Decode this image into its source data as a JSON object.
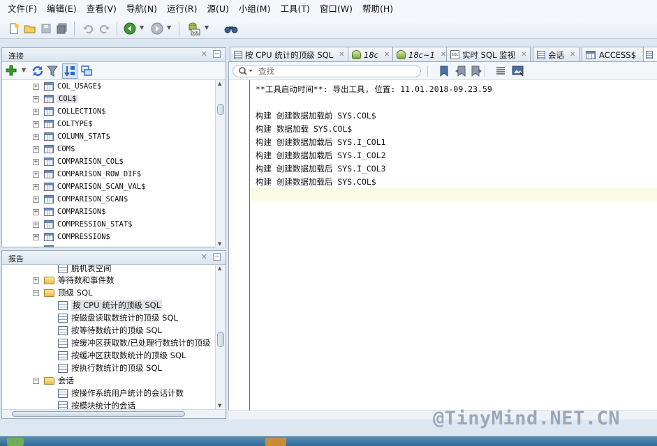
{
  "menu": [
    "文件(F)",
    "编辑(E)",
    "查看(V)",
    "导航(N)",
    "运行(R)",
    "源(U)",
    "小组(M)",
    "工具(T)",
    "窗口(W)",
    "帮助(H)"
  ],
  "toolbar_icons": [
    "new-icon",
    "open-icon",
    "save-icon",
    "save-all-icon",
    "undo-icon",
    "redo-icon",
    "back-icon",
    "forward-icon",
    "sql-worksheet-icon",
    "binoculars-icon"
  ],
  "connections": {
    "title": "连接",
    "items": [
      "COL_USAGE$",
      "COL$",
      "COLLECTION$",
      "COLTYPE$",
      "COLUMN_STAT$",
      "COM$",
      "COMPARISON_COL$",
      "COMPARISON_ROW_DIF$",
      "COMPARISON_SCAN_VAL$",
      "COMPARISON_SCAN$",
      "COMPARISON$",
      "COMPRESSION_STAT$",
      "COMPRESSION$"
    ],
    "selected": "COL$"
  },
  "reports": {
    "title": "报告",
    "partial_top": "脱机表空间",
    "items": [
      {
        "label": "等待数和事件数",
        "type": "folder",
        "expanded": false
      },
      {
        "label": "顶级 SQL",
        "type": "folder",
        "expanded": true
      },
      {
        "label": "按 CPU 统计的顶级 SQL",
        "type": "report",
        "selected": true
      },
      {
        "label": "按磁盘读取数统计的顶级 SQL",
        "type": "report"
      },
      {
        "label": "按等待数统计的顶级 SQL",
        "type": "report"
      },
      {
        "label": "按缓冲区获取数/已处理行数统计的顶级",
        "type": "report"
      },
      {
        "label": "按缓冲区获取数统计的顶级 SQL",
        "type": "report"
      },
      {
        "label": "按执行数统计的顶级 SQL",
        "type": "report"
      },
      {
        "label": "会话",
        "type": "folder",
        "expanded": true
      },
      {
        "label": "按操作系统用户统计的会话计数",
        "type": "report"
      },
      {
        "label": "按模块统计的会话",
        "type": "report"
      }
    ]
  },
  "tabs": [
    {
      "label": "按 CPU 统计的顶级 SQL",
      "icon": "report-icon",
      "closable": true
    },
    {
      "label": "18c",
      "icon": "sql-db-icon",
      "closable": true,
      "italic": true
    },
    {
      "label": "18c~1",
      "icon": "sql-db-icon",
      "closable": true,
      "italic": true
    },
    {
      "label": "实时 SQL 监视",
      "icon": "sql-icon",
      "closable": true
    },
    {
      "label": "会话",
      "icon": "report-icon",
      "closable": true
    },
    {
      "label": "ACCESS$",
      "icon": "table-icon",
      "closable": true
    }
  ],
  "find": {
    "placeholder": "查找"
  },
  "log": {
    "header": "**工具启动时间**: 导出工具, 位置: 11.01.2018-09.23.59",
    "lines": [
      "构建 创建数据加载前 SYS.COL$",
      "构建 数据加载 SYS.COL$",
      "构建 创建数据加载后 SYS.I_COL1",
      "构建 创建数据加载后 SYS.I_COL2",
      "构建 创建数据加载后 SYS.I_COL3",
      "构建 创建数据加载后 SYS.COL$"
    ]
  },
  "watermark": "@TinyMind.NET.CN"
}
